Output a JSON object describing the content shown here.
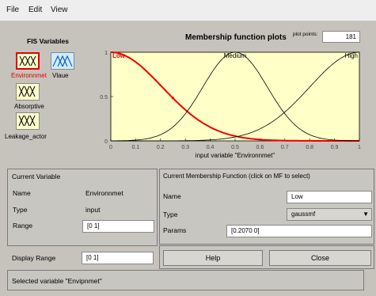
{
  "menu": {
    "file": "File",
    "edit": "Edit",
    "view": "View"
  },
  "fis": {
    "title": "FIS Variables",
    "vars": [
      {
        "label": "Environnmet",
        "kind": "input",
        "selected": true
      },
      {
        "label": "Vlaue",
        "kind": "output",
        "selected": false
      },
      {
        "label": "Absorptive",
        "kind": "input",
        "selected": false
      },
      {
        "label": "Leakage_actor",
        "kind": "input",
        "selected": false
      }
    ]
  },
  "plot": {
    "title": "Membership function plots",
    "points_label": "plot points:",
    "points_value": "181",
    "xlabel": "input variable \"Environnmet\"",
    "mf_labels": [
      "Low",
      "Medium",
      "High"
    ]
  },
  "chart_data": {
    "type": "line",
    "title": "Membership function plots",
    "xlabel": "input variable \"Environnmet\"",
    "ylabel": "",
    "xlim": [
      0,
      1
    ],
    "ylim": [
      0,
      1
    ],
    "xticks": [
      "0",
      "0.1",
      "0.2",
      "0.3",
      "0.4",
      "0.5",
      "0.6",
      "0.7",
      "0.8",
      "0.9",
      "1"
    ],
    "yticks": [
      "0",
      "0.5",
      "1"
    ],
    "series": [
      {
        "name": "Low",
        "mf": "gaussmf",
        "sigma": 0.207,
        "center": 0,
        "color": "#ee0000",
        "highlighted": true
      },
      {
        "name": "Medium",
        "mf": "gaussmf",
        "sigma": 0.13,
        "center": 0.5,
        "color": "#000000",
        "highlighted": false
      },
      {
        "name": "High",
        "mf": "gaussmf",
        "sigma": 0.2,
        "center": 1,
        "color": "#000000",
        "highlighted": false
      }
    ]
  },
  "current_variable": {
    "title": "Current Variable",
    "name_label": "Name",
    "name_value": "Environnmet",
    "type_label": "Type",
    "type_value": "input",
    "range_label": "Range",
    "range_value": "[0 1]",
    "display_range_label": "Display Range",
    "display_range_value": "[0 1]"
  },
  "current_mf": {
    "title": "Current Membership Function (click on MF to select)",
    "name_label": "Name",
    "name_value": "Low",
    "type_label": "Type",
    "type_value": "gaussmf",
    "params_label": "Params",
    "params_value": "[0.2070 0]"
  },
  "buttons": {
    "help": "Help",
    "close": "Close"
  },
  "status": "Selected variable \"Envipnmet\"",
  "colors": {
    "plot_bg": "#ffffc8",
    "selected_curve": "#ee0000",
    "selected_border": "#e00000"
  }
}
